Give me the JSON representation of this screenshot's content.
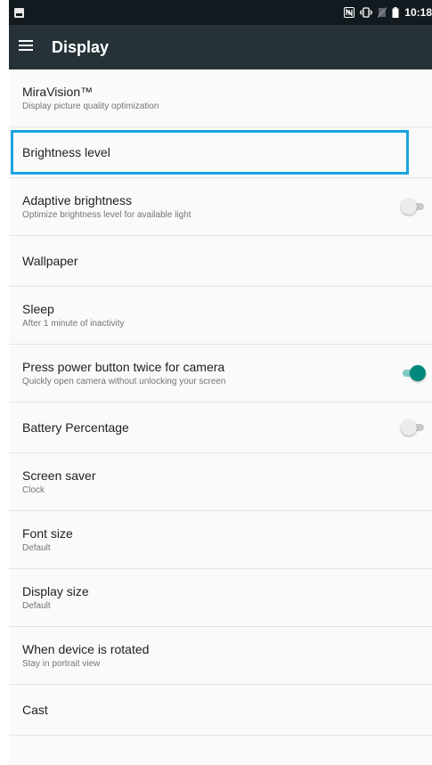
{
  "status_bar": {
    "time": "10:18",
    "icons": [
      "notification-icon",
      "nfc-icon",
      "vibrate-icon",
      "no-sim-icon",
      "battery-icon"
    ]
  },
  "app_bar": {
    "menu_icon": "menu-icon",
    "title": "Display"
  },
  "colors": {
    "status_bar": "#121a1f",
    "app_bar": "#263238",
    "accent": "#00897b",
    "highlight": "#1aa3e0"
  },
  "items": [
    {
      "title": "MiraVision™",
      "summary": "Display picture quality optimization"
    },
    {
      "title": "Brightness level",
      "highlighted": true
    },
    {
      "title": "Adaptive brightness",
      "summary": "Optimize brightness level for available light",
      "switch": false
    },
    {
      "title": "Wallpaper"
    },
    {
      "title": "Sleep",
      "summary": "After 1 minute of inactivity"
    },
    {
      "title": "Press power button twice for camera",
      "summary": "Quickly open camera without unlocking your screen",
      "switch": true
    },
    {
      "title": "Battery Percentage",
      "switch": false
    },
    {
      "title": "Screen saver",
      "summary": "Clock"
    },
    {
      "title": "Font size",
      "summary": "Default"
    },
    {
      "title": "Display size",
      "summary": "Default"
    },
    {
      "title": "When device is rotated",
      "summary": "Stay in portrait view"
    },
    {
      "title": "Cast"
    }
  ]
}
